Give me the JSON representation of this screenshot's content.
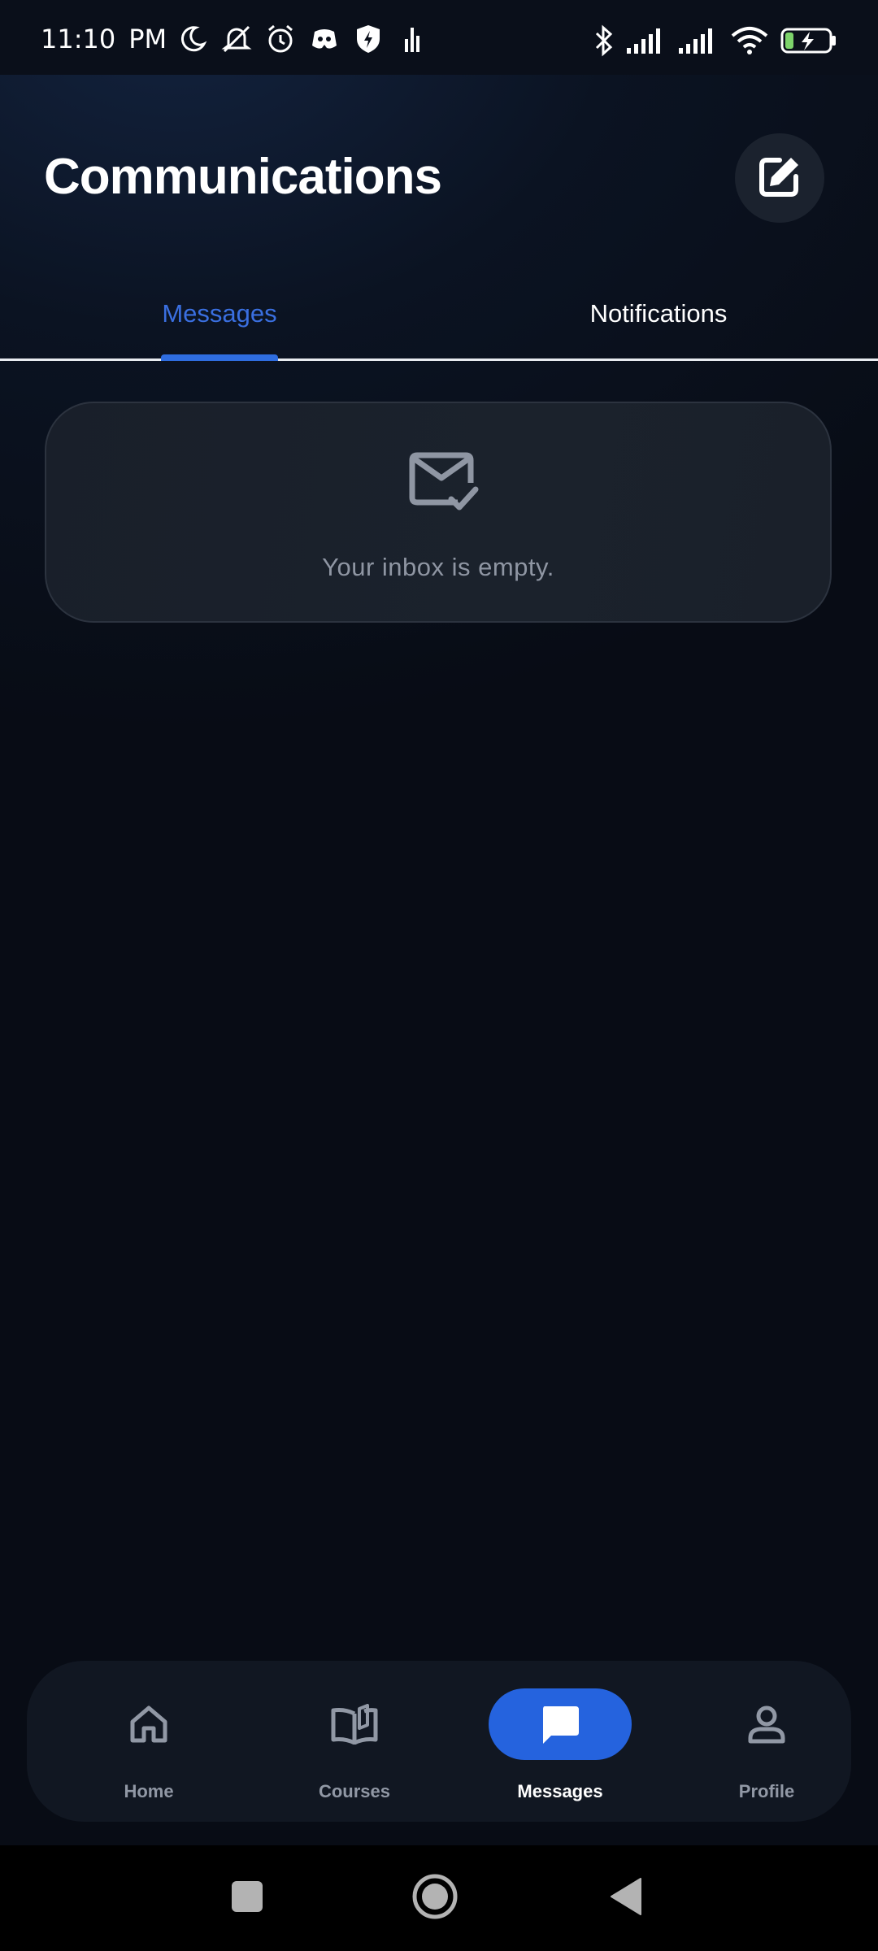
{
  "status_bar": {
    "time": "11:10",
    "ampm": "PM",
    "left_icons": [
      "moon-icon",
      "mute-icon",
      "alarm-icon",
      "discord-icon",
      "shield-icon",
      "bars-icon"
    ],
    "right_icons": [
      "bluetooth-icon",
      "signal-icon",
      "signal-icon",
      "wifi-icon",
      "battery-charging-icon"
    ]
  },
  "header": {
    "title": "Communications",
    "compose_icon": "edit-icon"
  },
  "tabs": [
    {
      "label": "Messages",
      "active": true
    },
    {
      "label": "Notifications",
      "active": false
    }
  ],
  "empty_state": {
    "icon": "mail-check-icon",
    "text": "Your inbox is empty."
  },
  "bottom_nav": [
    {
      "label": "Home",
      "icon": "home-icon",
      "active": false
    },
    {
      "label": "Courses",
      "icon": "book-icon",
      "active": false
    },
    {
      "label": "Messages",
      "icon": "chat-icon",
      "active": true
    },
    {
      "label": "Profile",
      "icon": "person-icon",
      "active": false
    }
  ],
  "colors": {
    "accent": "#2563de",
    "active_tab": "#3a6fe0",
    "background": "#080c15",
    "card": "#1a202a",
    "muted_text": "#8f96a3"
  }
}
